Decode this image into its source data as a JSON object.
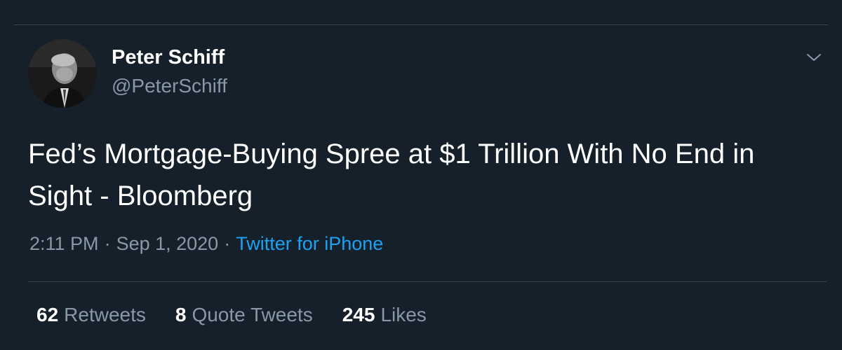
{
  "tweet": {
    "author": {
      "display_name": "Peter Schiff",
      "handle": "@PeterSchiff"
    },
    "text": "Fed’s Mortgage-Buying Spree at $1 Trillion With No End in Sight - Bloomberg",
    "time": "2:11 PM",
    "separator": "·",
    "date": "Sep 1, 2020",
    "source": "Twitter for iPhone",
    "more_icon": "chevron-down-icon",
    "stats": {
      "retweets": {
        "count": "62",
        "label": "Retweets"
      },
      "quote_tweets": {
        "count": "8",
        "label": "Quote Tweets"
      },
      "likes": {
        "count": "245",
        "label": "Likes"
      }
    }
  },
  "colors": {
    "background": "#15202b",
    "divider": "#38444d",
    "secondary_text": "#8899a6",
    "link": "#1da1f2",
    "primary_text": "#ffffff"
  }
}
